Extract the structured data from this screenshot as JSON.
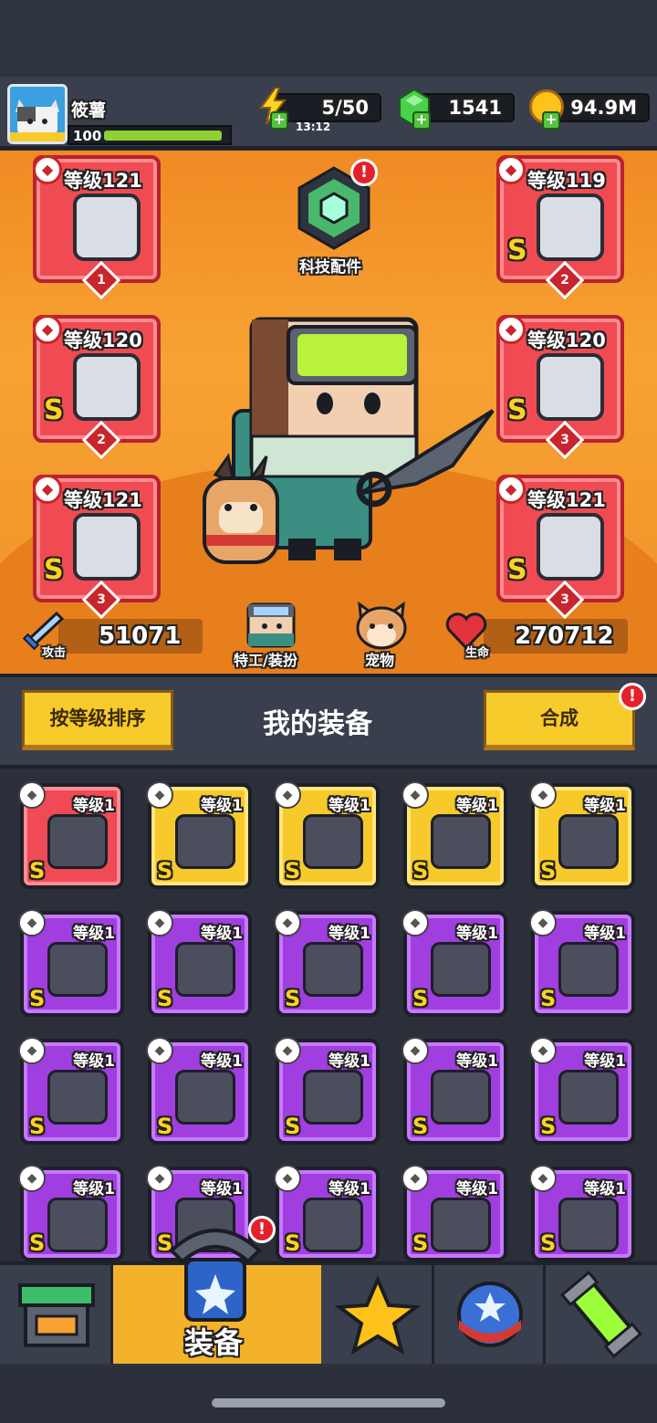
{
  "player": {
    "name": "筱薯",
    "level": "100",
    "xp_fraction": 0.95
  },
  "resources": {
    "energy": "5/50",
    "energy_timer": "13:12",
    "gems": "1541",
    "coins": "94.9M"
  },
  "tech_parts_label": "科技配件",
  "equipped_slots": [
    {
      "level": "等级121",
      "number": "1",
      "grade": "",
      "icon": "kunai-icon"
    },
    {
      "level": "等级119",
      "number": "2",
      "grade": "S",
      "icon": "armor-icon"
    },
    {
      "level": "等级120",
      "number": "2",
      "grade": "S",
      "icon": "necklace-icon"
    },
    {
      "level": "等级120",
      "number": "3",
      "grade": "S",
      "icon": "belt-icon"
    },
    {
      "level": "等级121",
      "number": "3",
      "grade": "S",
      "icon": "gauntlet-icon"
    },
    {
      "level": "等级121",
      "number": "3",
      "grade": "S",
      "icon": "boots-icon"
    }
  ],
  "stats": {
    "attack_label": "攻击",
    "attack": "51071",
    "hp_label": "生命",
    "hp": "270712"
  },
  "mid_buttons": {
    "agent": "特工/装扮",
    "pet": "宠物"
  },
  "section": {
    "sort_button": "按等级排序",
    "title": "我的装备",
    "merge_button": "合成"
  },
  "inventory": [
    {
      "level": "等级1",
      "rarity": "red",
      "grade": "S"
    },
    {
      "level": "等级1",
      "rarity": "yellow",
      "grade": "S"
    },
    {
      "level": "等级1",
      "rarity": "yellow",
      "grade": "S"
    },
    {
      "level": "等级1",
      "rarity": "yellow",
      "grade": "S"
    },
    {
      "level": "等级1",
      "rarity": "yellow",
      "grade": "S"
    },
    {
      "level": "等级1",
      "rarity": "purple",
      "grade": "S"
    },
    {
      "level": "等级1",
      "rarity": "purple",
      "grade": "S"
    },
    {
      "level": "等级1",
      "rarity": "purple",
      "grade": "S"
    },
    {
      "level": "等级1",
      "rarity": "purple",
      "grade": "S"
    },
    {
      "level": "等级1",
      "rarity": "purple",
      "grade": "S"
    },
    {
      "level": "等级1",
      "rarity": "purple",
      "grade": "S"
    },
    {
      "level": "等级1",
      "rarity": "purple",
      "grade": "S"
    },
    {
      "level": "等级1",
      "rarity": "purple",
      "grade": "S"
    },
    {
      "level": "等级1",
      "rarity": "purple",
      "grade": "S"
    },
    {
      "level": "等级1",
      "rarity": "purple",
      "grade": "S"
    },
    {
      "level": "等级1",
      "rarity": "purple",
      "grade": "S"
    },
    {
      "level": "等级1",
      "rarity": "purple",
      "grade": "S"
    },
    {
      "level": "等级1",
      "rarity": "purple",
      "grade": "S"
    },
    {
      "level": "等级1",
      "rarity": "purple",
      "grade": "S"
    },
    {
      "level": "等级1",
      "rarity": "purple",
      "grade": "S"
    }
  ],
  "nav": {
    "active_label": "装备",
    "tabs": [
      "shop-icon",
      "equipment-icon",
      "star-icon",
      "ball-icon",
      "dna-icon"
    ]
  },
  "colors": {
    "accent_orange": "#f7a233",
    "slot_red": "#f04b53",
    "gem_green": "#48d14a",
    "badge_red": "#e3212c"
  }
}
